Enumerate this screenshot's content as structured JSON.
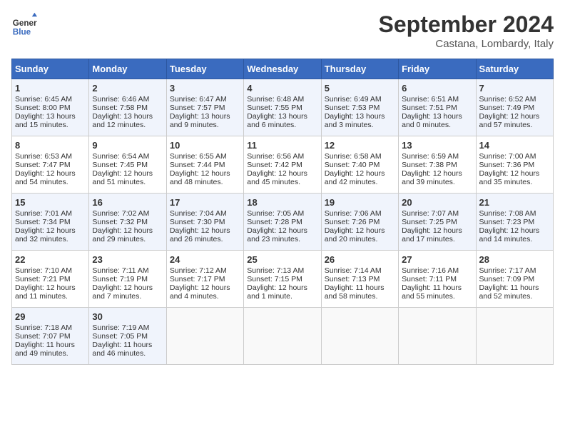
{
  "header": {
    "logo_line1": "General",
    "logo_line2": "Blue",
    "month_title": "September 2024",
    "location": "Castana, Lombardy, Italy"
  },
  "days_of_week": [
    "Sunday",
    "Monday",
    "Tuesday",
    "Wednesday",
    "Thursday",
    "Friday",
    "Saturday"
  ],
  "weeks": [
    [
      {
        "day": "1",
        "lines": [
          "Sunrise: 6:45 AM",
          "Sunset: 8:00 PM",
          "Daylight: 13 hours",
          "and 15 minutes."
        ]
      },
      {
        "day": "2",
        "lines": [
          "Sunrise: 6:46 AM",
          "Sunset: 7:58 PM",
          "Daylight: 13 hours",
          "and 12 minutes."
        ]
      },
      {
        "day": "3",
        "lines": [
          "Sunrise: 6:47 AM",
          "Sunset: 7:57 PM",
          "Daylight: 13 hours",
          "and 9 minutes."
        ]
      },
      {
        "day": "4",
        "lines": [
          "Sunrise: 6:48 AM",
          "Sunset: 7:55 PM",
          "Daylight: 13 hours",
          "and 6 minutes."
        ]
      },
      {
        "day": "5",
        "lines": [
          "Sunrise: 6:49 AM",
          "Sunset: 7:53 PM",
          "Daylight: 13 hours",
          "and 3 minutes."
        ]
      },
      {
        "day": "6",
        "lines": [
          "Sunrise: 6:51 AM",
          "Sunset: 7:51 PM",
          "Daylight: 13 hours",
          "and 0 minutes."
        ]
      },
      {
        "day": "7",
        "lines": [
          "Sunrise: 6:52 AM",
          "Sunset: 7:49 PM",
          "Daylight: 12 hours",
          "and 57 minutes."
        ]
      }
    ],
    [
      {
        "day": "8",
        "lines": [
          "Sunrise: 6:53 AM",
          "Sunset: 7:47 PM",
          "Daylight: 12 hours",
          "and 54 minutes."
        ]
      },
      {
        "day": "9",
        "lines": [
          "Sunrise: 6:54 AM",
          "Sunset: 7:45 PM",
          "Daylight: 12 hours",
          "and 51 minutes."
        ]
      },
      {
        "day": "10",
        "lines": [
          "Sunrise: 6:55 AM",
          "Sunset: 7:44 PM",
          "Daylight: 12 hours",
          "and 48 minutes."
        ]
      },
      {
        "day": "11",
        "lines": [
          "Sunrise: 6:56 AM",
          "Sunset: 7:42 PM",
          "Daylight: 12 hours",
          "and 45 minutes."
        ]
      },
      {
        "day": "12",
        "lines": [
          "Sunrise: 6:58 AM",
          "Sunset: 7:40 PM",
          "Daylight: 12 hours",
          "and 42 minutes."
        ]
      },
      {
        "day": "13",
        "lines": [
          "Sunrise: 6:59 AM",
          "Sunset: 7:38 PM",
          "Daylight: 12 hours",
          "and 39 minutes."
        ]
      },
      {
        "day": "14",
        "lines": [
          "Sunrise: 7:00 AM",
          "Sunset: 7:36 PM",
          "Daylight: 12 hours",
          "and 35 minutes."
        ]
      }
    ],
    [
      {
        "day": "15",
        "lines": [
          "Sunrise: 7:01 AM",
          "Sunset: 7:34 PM",
          "Daylight: 12 hours",
          "and 32 minutes."
        ]
      },
      {
        "day": "16",
        "lines": [
          "Sunrise: 7:02 AM",
          "Sunset: 7:32 PM",
          "Daylight: 12 hours",
          "and 29 minutes."
        ]
      },
      {
        "day": "17",
        "lines": [
          "Sunrise: 7:04 AM",
          "Sunset: 7:30 PM",
          "Daylight: 12 hours",
          "and 26 minutes."
        ]
      },
      {
        "day": "18",
        "lines": [
          "Sunrise: 7:05 AM",
          "Sunset: 7:28 PM",
          "Daylight: 12 hours",
          "and 23 minutes."
        ]
      },
      {
        "day": "19",
        "lines": [
          "Sunrise: 7:06 AM",
          "Sunset: 7:26 PM",
          "Daylight: 12 hours",
          "and 20 minutes."
        ]
      },
      {
        "day": "20",
        "lines": [
          "Sunrise: 7:07 AM",
          "Sunset: 7:25 PM",
          "Daylight: 12 hours",
          "and 17 minutes."
        ]
      },
      {
        "day": "21",
        "lines": [
          "Sunrise: 7:08 AM",
          "Sunset: 7:23 PM",
          "Daylight: 12 hours",
          "and 14 minutes."
        ]
      }
    ],
    [
      {
        "day": "22",
        "lines": [
          "Sunrise: 7:10 AM",
          "Sunset: 7:21 PM",
          "Daylight: 12 hours",
          "and 11 minutes."
        ]
      },
      {
        "day": "23",
        "lines": [
          "Sunrise: 7:11 AM",
          "Sunset: 7:19 PM",
          "Daylight: 12 hours",
          "and 7 minutes."
        ]
      },
      {
        "day": "24",
        "lines": [
          "Sunrise: 7:12 AM",
          "Sunset: 7:17 PM",
          "Daylight: 12 hours",
          "and 4 minutes."
        ]
      },
      {
        "day": "25",
        "lines": [
          "Sunrise: 7:13 AM",
          "Sunset: 7:15 PM",
          "Daylight: 12 hours",
          "and 1 minute."
        ]
      },
      {
        "day": "26",
        "lines": [
          "Sunrise: 7:14 AM",
          "Sunset: 7:13 PM",
          "Daylight: 11 hours",
          "and 58 minutes."
        ]
      },
      {
        "day": "27",
        "lines": [
          "Sunrise: 7:16 AM",
          "Sunset: 7:11 PM",
          "Daylight: 11 hours",
          "and 55 minutes."
        ]
      },
      {
        "day": "28",
        "lines": [
          "Sunrise: 7:17 AM",
          "Sunset: 7:09 PM",
          "Daylight: 11 hours",
          "and 52 minutes."
        ]
      }
    ],
    [
      {
        "day": "29",
        "lines": [
          "Sunrise: 7:18 AM",
          "Sunset: 7:07 PM",
          "Daylight: 11 hours",
          "and 49 minutes."
        ]
      },
      {
        "day": "30",
        "lines": [
          "Sunrise: 7:19 AM",
          "Sunset: 7:05 PM",
          "Daylight: 11 hours",
          "and 46 minutes."
        ]
      },
      {
        "day": "",
        "lines": []
      },
      {
        "day": "",
        "lines": []
      },
      {
        "day": "",
        "lines": []
      },
      {
        "day": "",
        "lines": []
      },
      {
        "day": "",
        "lines": []
      }
    ]
  ]
}
